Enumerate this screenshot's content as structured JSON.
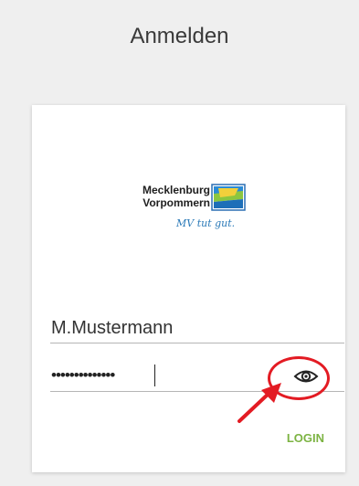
{
  "page": {
    "title": "Anmelden"
  },
  "logo": {
    "line1": "Mecklenburg",
    "line2": "Vorpommern",
    "slogan": "MV tut gut."
  },
  "form": {
    "username_value": "M.Mustermann",
    "password_dots": "••••••••••••••",
    "show_password_icon": "eye-icon",
    "login_label": "LOGIN"
  },
  "colors": {
    "accent": "#7cb342",
    "annotation": "#e31b23"
  }
}
